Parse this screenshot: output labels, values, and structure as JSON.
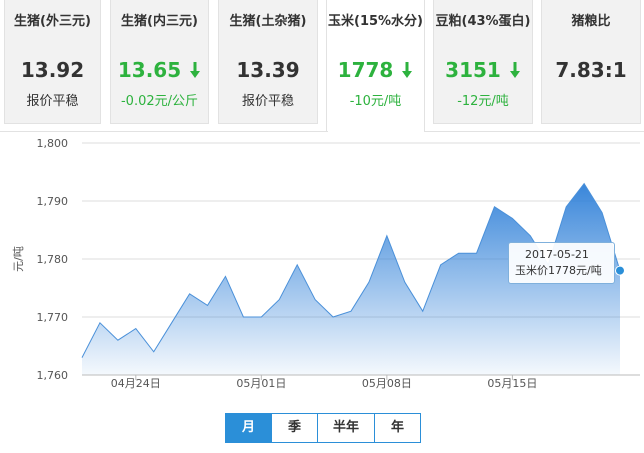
{
  "tabs": [
    {
      "title": "生猪(外三元)",
      "value": "13.92",
      "sub": "报价平稳",
      "trend": "flat"
    },
    {
      "title": "生猪(内三元)",
      "value": "13.65",
      "sub": "-0.02元/公斤",
      "trend": "down"
    },
    {
      "title": "生猪(土杂猪)",
      "value": "13.39",
      "sub": "报价平稳",
      "trend": "flat"
    },
    {
      "title": "玉米(15%水分)",
      "value": "1778",
      "sub": "-10元/吨",
      "trend": "down",
      "active": true
    },
    {
      "title": "豆粕(43%蛋白)",
      "value": "3151",
      "sub": "-12元/吨",
      "trend": "down"
    },
    {
      "title": "猪粮比",
      "value": "7.83:1",
      "sub": "",
      "trend": "flat"
    }
  ],
  "colors": {
    "green": "#2db23e",
    "accent": "#2b8fd8",
    "line": "#4a90d9"
  },
  "icons": {
    "down": "arrow-down-icon"
  },
  "chart_data": {
    "type": "area",
    "ylabel": "元/吨",
    "ylim": [
      1760,
      1800
    ],
    "yticks": [
      1760,
      1770,
      1780,
      1790,
      1800
    ],
    "ytick_labels": [
      "1,760",
      "1,770",
      "1,780",
      "1,790",
      "1,800"
    ],
    "x": [
      "04-21",
      "04-22",
      "04-23",
      "04-24",
      "04-25",
      "04-26",
      "04-27",
      "04-28",
      "04-29",
      "04-30",
      "05-01",
      "05-02",
      "05-03",
      "05-04",
      "05-05",
      "05-06",
      "05-07",
      "05-08",
      "05-09",
      "05-10",
      "05-11",
      "05-12",
      "05-13",
      "05-14",
      "05-15",
      "05-16",
      "05-17",
      "05-18",
      "05-19",
      "05-20",
      "05-21"
    ],
    "values": [
      1763,
      1769,
      1766,
      1768,
      1764,
      1769,
      1774,
      1772,
      1777,
      1770,
      1770,
      1773,
      1779,
      1773,
      1770,
      1771,
      1776,
      1784,
      1776,
      1771,
      1779,
      1781,
      1781,
      1789,
      1787,
      1784,
      1779,
      1789,
      1793,
      1788,
      1778
    ],
    "xtick_labels": [
      {
        "x": "04-24",
        "label": "04月24日"
      },
      {
        "x": "05-01",
        "label": "05月01日"
      },
      {
        "x": "05-08",
        "label": "05月08日"
      },
      {
        "x": "05-15",
        "label": "05月15日"
      }
    ],
    "grid": true,
    "tooltip": {
      "date": "2017-05-21",
      "text": "玉米价1778元/吨"
    }
  },
  "range_buttons": [
    {
      "label": "月",
      "selected": true
    },
    {
      "label": "季",
      "selected": false
    },
    {
      "label": "半年",
      "selected": false
    },
    {
      "label": "年",
      "selected": false
    }
  ]
}
